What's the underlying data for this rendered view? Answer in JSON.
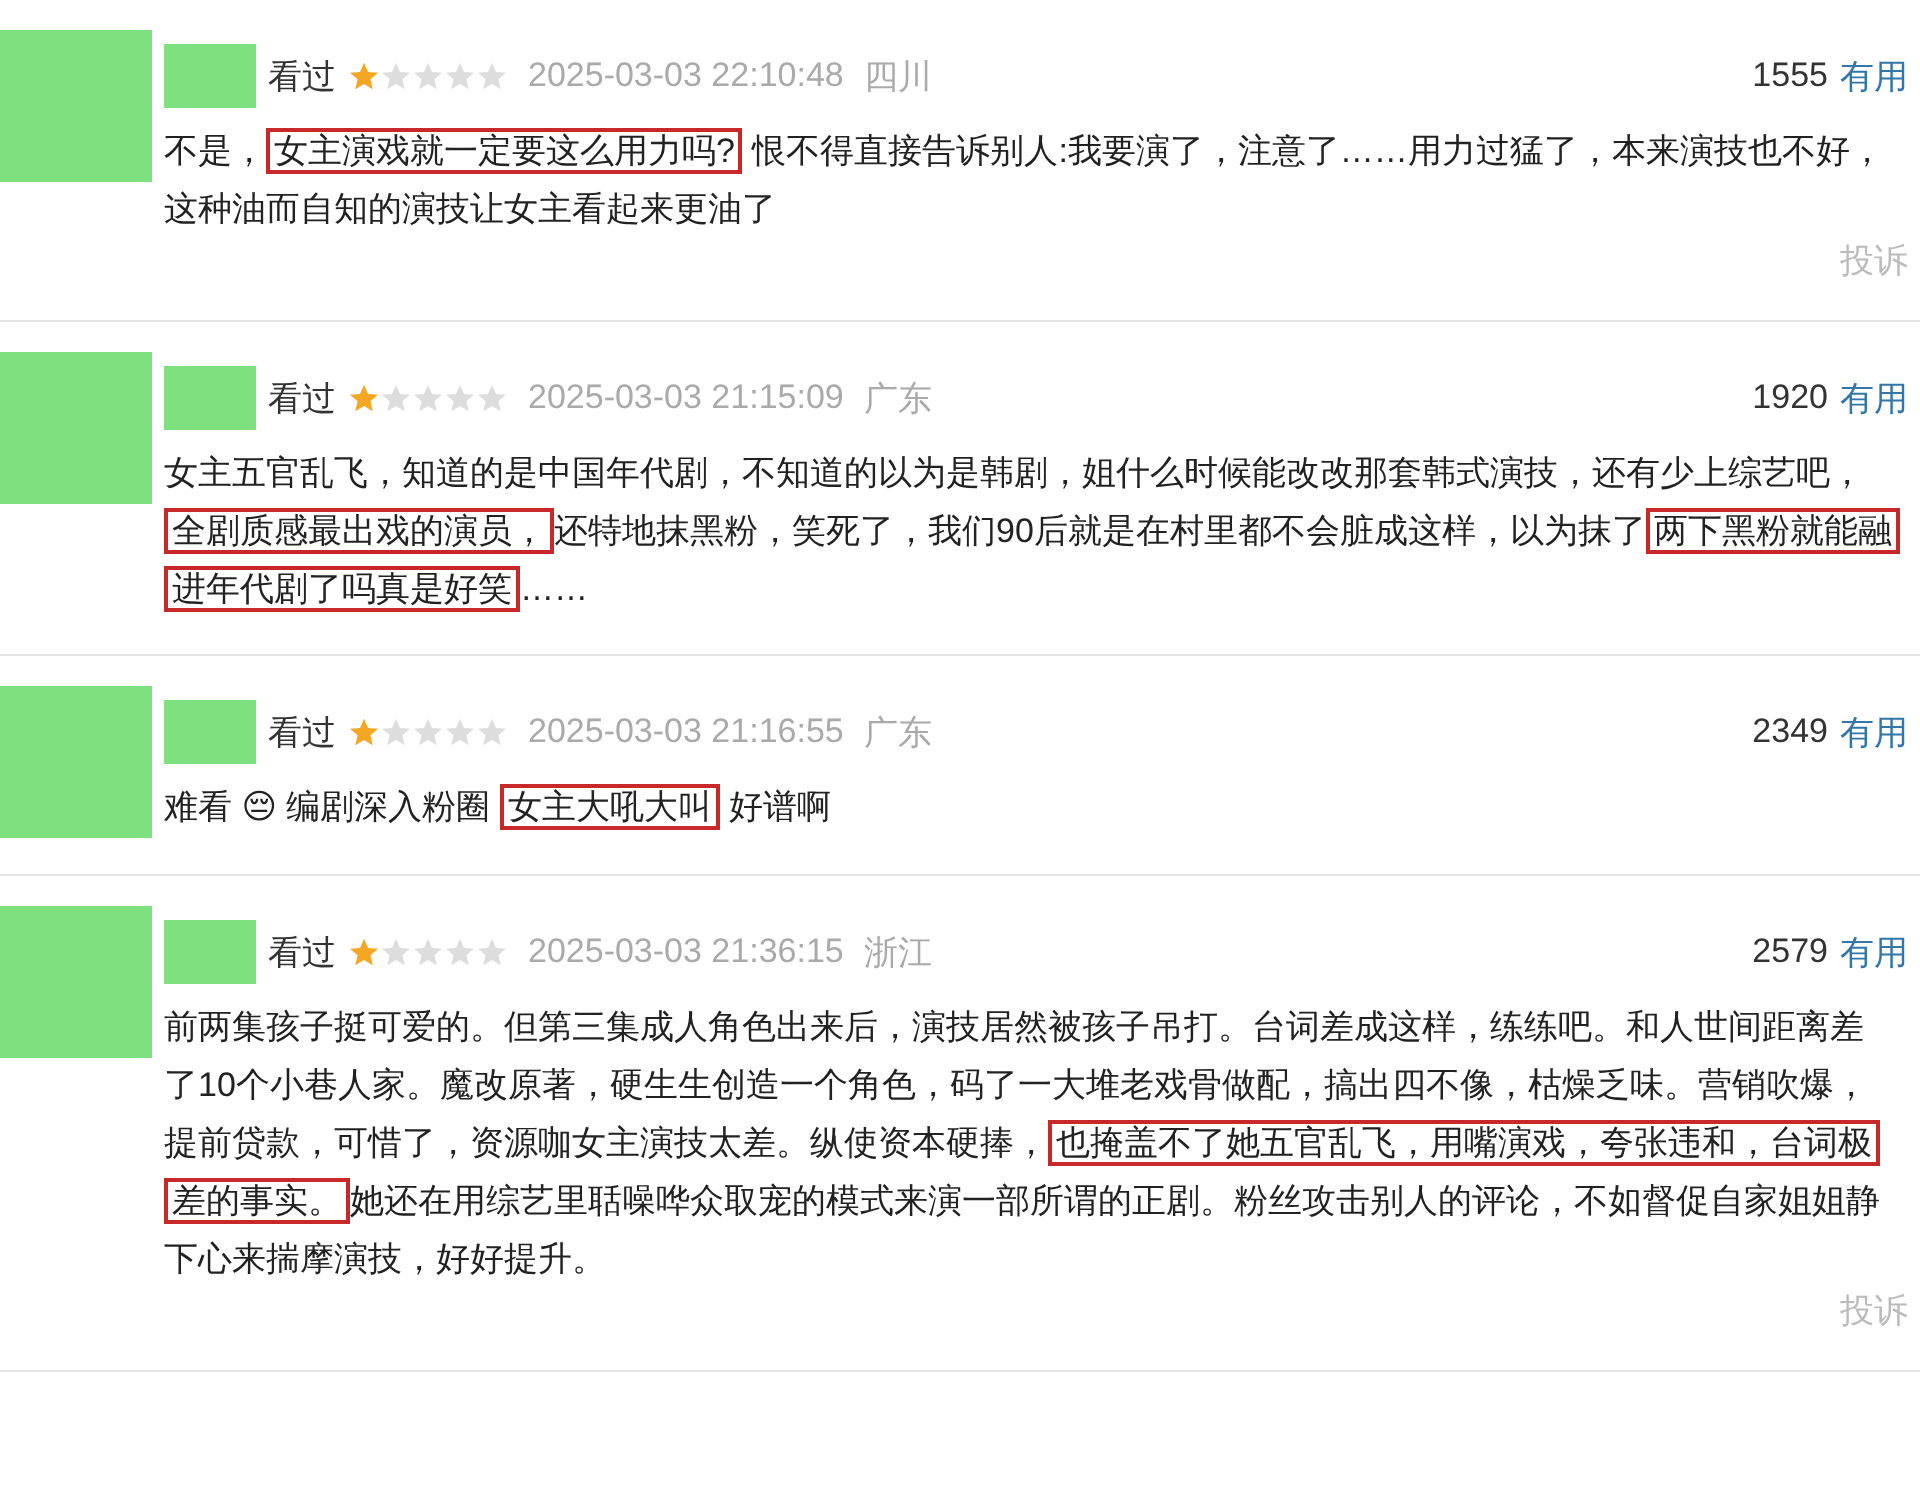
{
  "reviews": [
    {
      "watched": "看过",
      "stars": 1,
      "time": "2025-03-03 22:10:48",
      "region": "四川",
      "votes": "1555",
      "useful": "有用",
      "report": "投诉",
      "segments": [
        {
          "text": "不是，",
          "highlighted": false
        },
        {
          "text": "女主演戏就一定要这么用力吗?",
          "highlighted": true
        },
        {
          "text": " 恨不得直接告诉别人:我要演了，注意了……用力过猛了，本来演技也不好，这种油而自知的演技让女主看起来更油了",
          "highlighted": false
        }
      ]
    },
    {
      "watched": "看过",
      "stars": 1,
      "time": "2025-03-03 21:15:09",
      "region": "广东",
      "votes": "1920",
      "useful": "有用",
      "segments": [
        {
          "text": "女主五官乱飞，知道的是中国年代剧，不知道的以为是韩剧，姐什么时候能改改那套韩式演技，还有少上综艺吧，",
          "highlighted": false
        },
        {
          "text": "全剧质感最出戏的演员，",
          "highlighted": true
        },
        {
          "text": "还特地抹黑粉，笑死了，我们90后就是在村里都不会脏成这样，以为抹了",
          "highlighted": false
        },
        {
          "text": "两下黑粉就能融进年代剧了吗真是好笑",
          "highlighted": true
        },
        {
          "text": "……",
          "highlighted": false
        }
      ]
    },
    {
      "watched": "看过",
      "stars": 1,
      "time": "2025-03-03 21:16:55",
      "region": "广东",
      "votes": "2349",
      "useful": "有用",
      "segments": [
        {
          "text": "难看 😔 编剧深入粉圈 ",
          "highlighted": false
        },
        {
          "text": "女主大吼大叫",
          "highlighted": true
        },
        {
          "text": " 好谱啊",
          "highlighted": false
        }
      ]
    },
    {
      "watched": "看过",
      "stars": 1,
      "time": "2025-03-03 21:36:15",
      "region": "浙江",
      "votes": "2579",
      "useful": "有用",
      "report": "投诉",
      "segments": [
        {
          "text": "前两集孩子挺可爱的。但第三集成人角色出来后，演技居然被孩子吊打。台词差成这样，练练吧。和人世间距离差了10个小巷人家。魔改原著，硬生生创造一个角色，码了一大堆老戏骨做配，搞出四不像，枯燥乏味。营销吹爆，提前贷款，可惜了，资源咖女主演技太差。纵使资本硬捧，",
          "highlighted": false
        },
        {
          "text": "也掩盖不了她五官乱飞，用嘴演戏，夸张违和，台词极差的事实。",
          "highlighted": true
        },
        {
          "text": "她还在用综艺里聒噪哗众取宠的模式来演一部所谓的正剧。粉丝攻击别人的评论，不如督促自家姐姐静下心来揣摩演技，好好提升。",
          "highlighted": false
        }
      ]
    }
  ]
}
